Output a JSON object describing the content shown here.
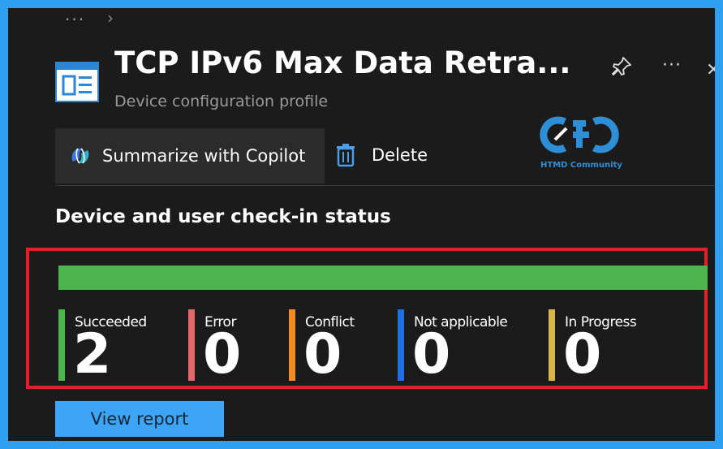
{
  "breadcrumb": {
    "ellipsis": "···",
    "separator": "›"
  },
  "header": {
    "title": "TCP IPv6 Max Data Retra...",
    "subtitle": "Device configuration profile",
    "icon": "profile-icon",
    "pin_icon": "pin-icon",
    "more_label": "···",
    "close_label": "✕"
  },
  "toolbar": {
    "copilot_label": "Summarize with Copilot",
    "copilot_icon": "copilot-icon",
    "delete_label": "Delete",
    "delete_icon": "trash-icon"
  },
  "watermark": {
    "text": "HTMD Community",
    "color": "#2e8fd6"
  },
  "section": {
    "title": "Device and user check-in status"
  },
  "status": {
    "progress_fraction": 1.0,
    "items": [
      {
        "label": "Succeeded",
        "value": "2",
        "color": "#4db34d"
      },
      {
        "label": "Error",
        "value": "0",
        "color": "#e06a6a"
      },
      {
        "label": "Conflict",
        "value": "0",
        "color": "#f08a22"
      },
      {
        "label": "Not applicable",
        "value": "0",
        "color": "#1f6fe0"
      },
      {
        "label": "In Progress",
        "value": "0",
        "color": "#d4b84c"
      }
    ]
  },
  "actions": {
    "view_report_label": "View report"
  },
  "colors": {
    "highlight_border": "#e0202a",
    "frame_bg": "#1b1b1b",
    "outer_bg": "#2f9ff0"
  }
}
